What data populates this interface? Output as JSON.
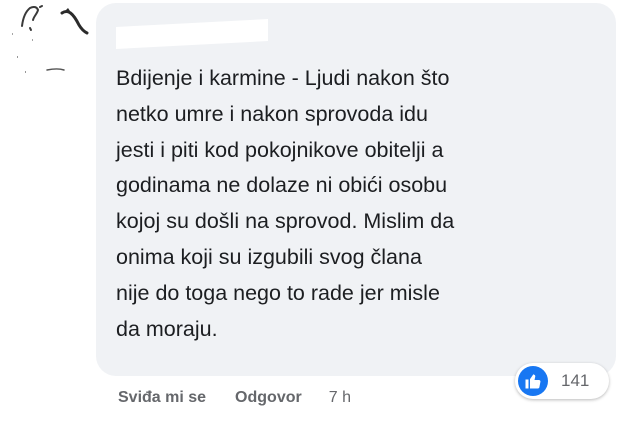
{
  "comment": {
    "author_name": "",
    "text": "Bdijenje i karmine - Ljudi nakon što\nnetko umre i nakon sprovoda idu\njesti i piti kod pokojnikove obitelji a\ngodinama ne dolaze ni obići osobu\nkojoj su došli na sprovod. Mislim da\nonima koji su izgubili svog člana\nnije do toga nego to rade jer misle\nda moraju."
  },
  "actions": {
    "like_label": "Sviđa mi se",
    "reply_label": "Odgovor",
    "timestamp": "7 h"
  },
  "reactions": {
    "count": "141",
    "icon": "thumbs-up-icon"
  },
  "colors": {
    "bubble_bg": "#f0f2f5",
    "text": "#1c1e21",
    "secondary_text": "#65676b",
    "like_blue": "#1877f2"
  }
}
